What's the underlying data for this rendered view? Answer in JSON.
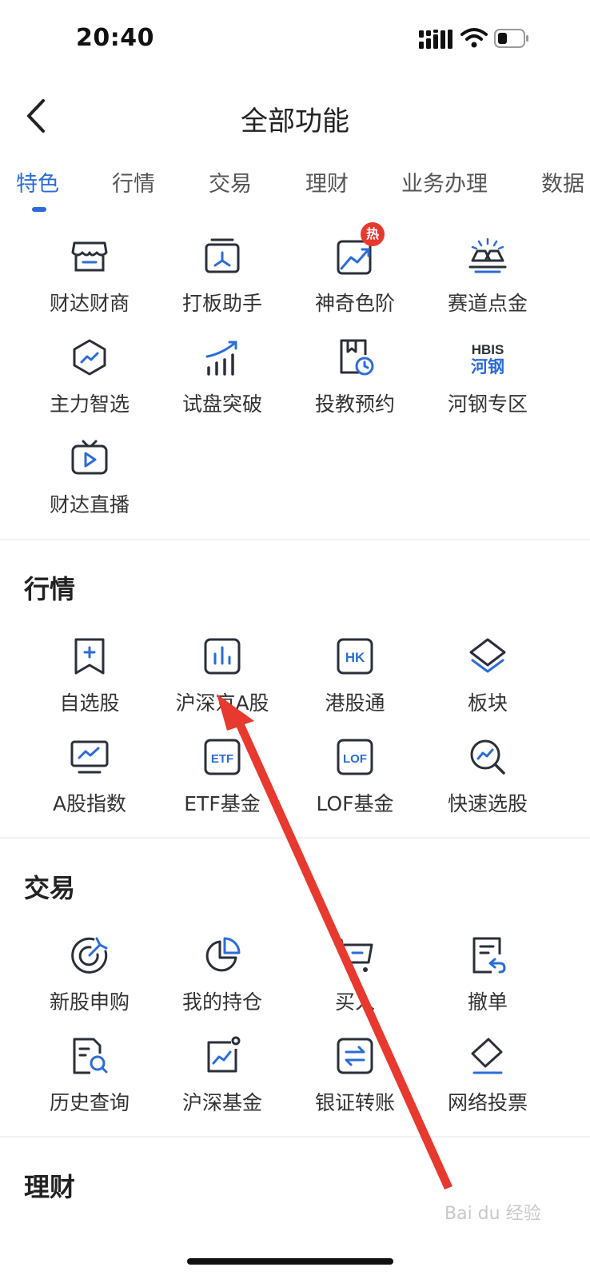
{
  "status_bar": {
    "time": "20:40"
  },
  "nav": {
    "title": "全部功能"
  },
  "tabs": [
    {
      "label": "特色"
    },
    {
      "label": "行情"
    },
    {
      "label": "交易"
    },
    {
      "label": "理财"
    },
    {
      "label": "业务办理"
    },
    {
      "label": "数据"
    }
  ],
  "featured": {
    "items": [
      {
        "label": "财达财商",
        "icon": "shop-icon"
      },
      {
        "label": "打板助手",
        "icon": "board-helper-icon"
      },
      {
        "label": "神奇色阶",
        "icon": "trend-chart-icon",
        "badge": "热"
      },
      {
        "label": "赛道点金",
        "icon": "gold-bar-icon"
      },
      {
        "label": "主力智选",
        "icon": "hexagon-trend-icon"
      },
      {
        "label": "试盘突破",
        "icon": "bars-rising-icon"
      },
      {
        "label": "投教预约",
        "icon": "book-clock-icon"
      },
      {
        "label": "河钢专区",
        "icon": "hbis-logo-icon",
        "logo_top": "HBIS",
        "logo_bottom": "河钢"
      },
      {
        "label": "财达直播",
        "icon": "tv-play-icon"
      }
    ]
  },
  "market": {
    "title": "行情",
    "items": [
      {
        "label": "自选股",
        "icon": "bookmark-plus-icon"
      },
      {
        "label": "沪深京A股",
        "icon": "bar-chart-icon"
      },
      {
        "label": "港股通",
        "icon": "hk-icon",
        "glyph": "HK"
      },
      {
        "label": "板块",
        "icon": "layers-icon"
      },
      {
        "label": "A股指数",
        "icon": "monitor-trend-icon"
      },
      {
        "label": "ETF基金",
        "icon": "etf-icon",
        "glyph": "ETF"
      },
      {
        "label": "LOF基金",
        "icon": "lof-icon",
        "glyph": "LOF"
      },
      {
        "label": "快速选股",
        "icon": "search-trend-icon"
      }
    ]
  },
  "trade": {
    "title": "交易",
    "items": [
      {
        "label": "新股申购",
        "icon": "target-icon"
      },
      {
        "label": "我的持仓",
        "icon": "pie-chart-icon"
      },
      {
        "label": "买入",
        "icon": "cart-icon"
      },
      {
        "label": "撤单",
        "icon": "document-undo-icon"
      },
      {
        "label": "历史查询",
        "icon": "document-search-icon"
      },
      {
        "label": "沪深基金",
        "icon": "fund-chart-icon"
      },
      {
        "label": "银证转账",
        "icon": "transfer-icon"
      },
      {
        "label": "网络投票",
        "icon": "vote-tag-icon"
      }
    ]
  },
  "finance": {
    "title": "理财"
  },
  "watermark": "Bai du 经验",
  "colors": {
    "accent": "#2b6cd9",
    "icon_dark": "#2a2f3a",
    "hot": "#e8392f",
    "arrow": "#e8392f"
  }
}
